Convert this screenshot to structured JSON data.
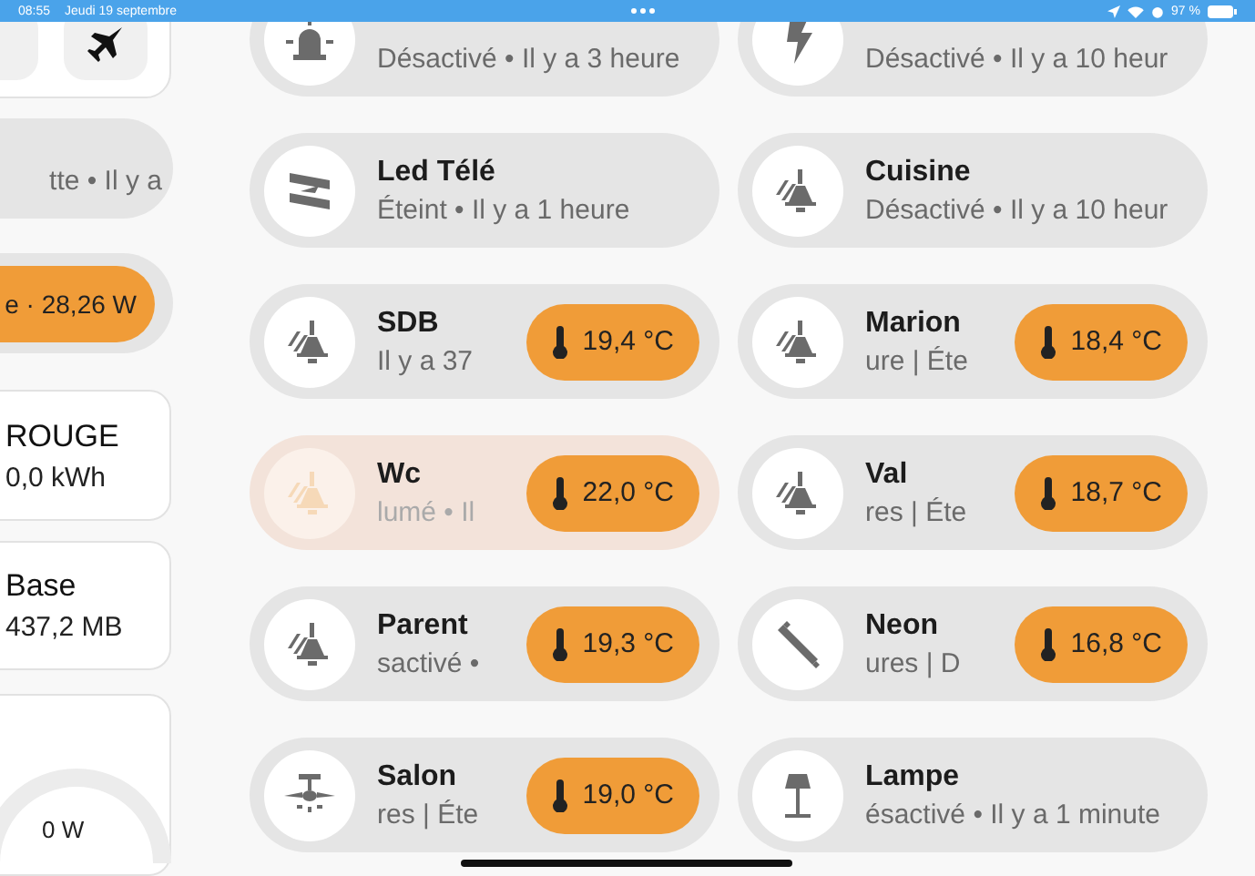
{
  "status_bar": {
    "time": "08:55",
    "date": "Jeudi 19 septembre",
    "battery": "97 %"
  },
  "left_column": {
    "activity_pill": {
      "subtitle": "tte • Il y a"
    },
    "power_chip": {
      "text": "e · 28,26 W"
    },
    "cards": [
      {
        "title": "ROUGE",
        "value": "0,0 kWh"
      },
      {
        "title": "Base",
        "value": "437,2 MB"
      }
    ],
    "gauge": {
      "value": "0 W"
    }
  },
  "tiles": [
    {
      "kind": "siren",
      "subtitle": "Désactivé • Il y a 3 heure",
      "active": false
    },
    {
      "kind": "bolt",
      "subtitle": "Désactivé • Il y a 10 heur",
      "active": false
    },
    {
      "kind": "strip",
      "title": "Led Télé",
      "subtitle": "Éteint • Il y a 1 heure",
      "active": false
    },
    {
      "kind": "pendant",
      "title": "Cuisine",
      "subtitle": "Désactivé • Il y a 10 heur",
      "active": false
    },
    {
      "kind": "pendant",
      "title": "SDB",
      "subtitle": "Il y a 37",
      "temperature": "19,4 °C",
      "active": false
    },
    {
      "kind": "pendant",
      "title": "Marion",
      "subtitle": "ure | Éte",
      "temperature": "18,4 °C",
      "active": false
    },
    {
      "kind": "pendant",
      "title": "Wc",
      "subtitle": "lumé • Il",
      "temperature": "22,0 °C",
      "active": true
    },
    {
      "kind": "pendant",
      "title": "Val",
      "subtitle": "res | Éte",
      "temperature": "18,7 °C",
      "active": false
    },
    {
      "kind": "pendant",
      "title": "Parent",
      "subtitle": "sactivé •",
      "temperature": "19,3 °C",
      "active": false
    },
    {
      "kind": "tube",
      "title": "Neon",
      "subtitle": "ures | D",
      "temperature": "16,8 °C",
      "active": false
    },
    {
      "kind": "fan",
      "title": "Salon",
      "subtitle": "res | Éte",
      "temperature": "19,0 °C",
      "active": false
    },
    {
      "kind": "floorlamp",
      "title": "Lampe",
      "subtitle": "ésactivé • Il y a 1 minute",
      "active": false
    }
  ]
}
